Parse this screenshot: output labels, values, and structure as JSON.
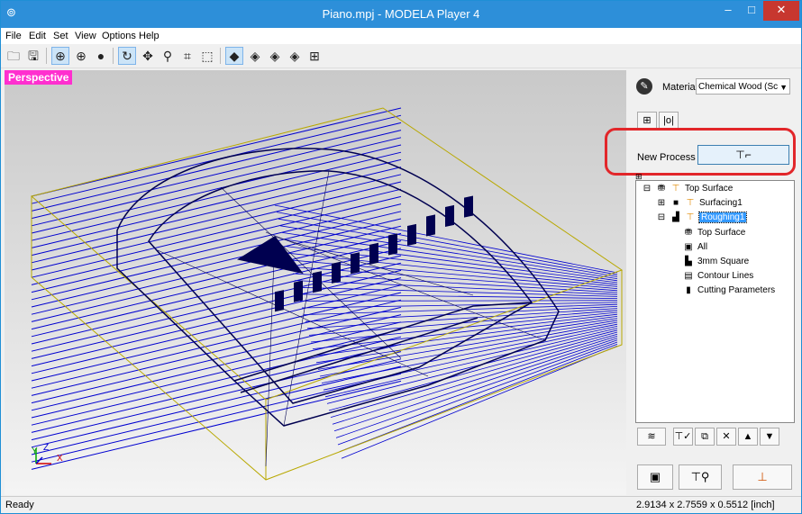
{
  "window": {
    "title": "Piano.mpj - MODELA Player 4",
    "minimize_glyph": "–",
    "maximize_glyph": "□",
    "close_glyph": "✕"
  },
  "menu": [
    "File",
    "Edit",
    "Set",
    "View",
    "Options",
    "Help"
  ],
  "toolbar": {
    "icons": [
      "open-icon",
      "save-icon",
      "wireframe-icon",
      "globe-icon",
      "sphere-icon",
      "rotate-icon",
      "pan-icon",
      "zoom-icon",
      "fit-icon",
      "zoom-region-icon",
      "view-iso-icon",
      "view-front-icon",
      "view-side-icon",
      "view-top-icon",
      "view-multi-icon"
    ]
  },
  "viewport": {
    "label": "Perspective",
    "axis_y": "Y",
    "axis_z": "Z",
    "axis_x": "X"
  },
  "panel": {
    "material_label": "Material",
    "material_value": "Chemical Wood (Sc",
    "new_process_label": "New Process",
    "tree": [
      {
        "label": "Top Surface",
        "level": 0,
        "expander": "⊟",
        "icon": "⛃"
      },
      {
        "label": "Surfacing1",
        "level": 1,
        "expander": "⊞",
        "icon": "■"
      },
      {
        "label": "Roughing1",
        "level": 1,
        "expander": "⊟",
        "icon": "▟",
        "selected": true
      },
      {
        "label": "Top Surface",
        "level": 2,
        "icon": "⛃"
      },
      {
        "label": "All",
        "level": 2,
        "icon": "▣"
      },
      {
        "label": "3mm Square",
        "level": 2,
        "icon": "▙"
      },
      {
        "label": "Contour Lines",
        "level": 2,
        "icon": "▤"
      },
      {
        "label": "Cutting Parameters",
        "level": 2,
        "icon": "▮"
      }
    ]
  },
  "status": {
    "left": "Ready",
    "right": "2.9134 x 2.7559 x 0.5512 [inch]"
  },
  "colors": {
    "titlebar": "#2d8fd9",
    "toolpath": "#0000d0",
    "highlight": "#e2262a",
    "perspective_label": "#ff2fcf"
  }
}
